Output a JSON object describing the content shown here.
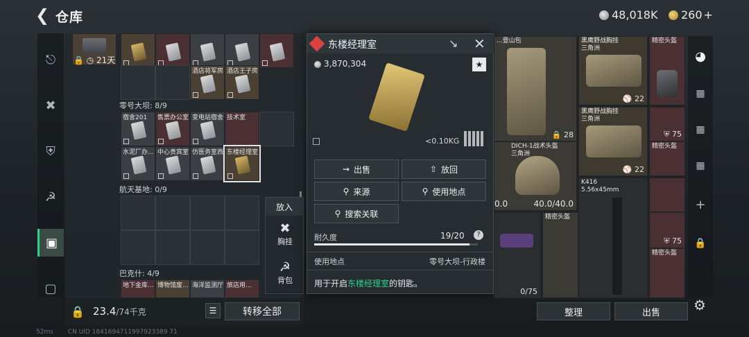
{
  "header": {
    "title": "仓库",
    "silver": "48,018K",
    "gold": "260",
    "gold_plus": "+"
  },
  "storage": {
    "timer": "21天",
    "row1_labels": [
      "",
      "",
      "",
      "",
      ""
    ],
    "row2_labels": [
      "",
      "",
      "酒店将军房",
      "酒店王子房"
    ],
    "dam_label": "零号大坝: 8/9",
    "dam_row1": [
      "宿舍201",
      "售票办公室",
      "变电站宿舍",
      "技术室"
    ],
    "dam_row2": [
      "水泥厂办...",
      "中心贵宾室",
      "仿医务室西",
      "东楼经理室"
    ],
    "space_label": "航天基地: 0/9",
    "bakshi_label": "巴克什: 4/9",
    "bakshi_row": [
      "地下金库...",
      "博物馆废...",
      "海洋监测厅",
      "旅店用..."
    ],
    "weight": "23.4",
    "weight_max": "/74千克",
    "transfer_all": "转移全部"
  },
  "context_menu": {
    "title": "放入",
    "item1": "胸挂",
    "item2": "背包"
  },
  "popup": {
    "title": "东楼经理室",
    "price": "3,870,304",
    "weight": "<0.10KG",
    "btn_sell": "出售",
    "btn_return": "放回",
    "btn_source": "来源",
    "btn_location": "使用地点",
    "btn_search": "搜索关联",
    "durability_label": "耐久度",
    "durability_value": "19/20",
    "durability_fraction": 0.95,
    "help": "?",
    "location_label": "使用地点",
    "location_value": "零号大坝-行政楼",
    "desc_prefix": "用于开启",
    "desc_link": "东楼经理室",
    "desc_suffix": "的钥匙。",
    "accent": "#2fcf8f"
  },
  "backpack": {
    "top_left_label": "...登山包",
    "item_chest1": "黑鹰野战胸挂\n三角洲",
    "item_chest1_val": "22",
    "item_mask1": "精密头盔",
    "item_chest2": "黑鹰野战胸挂\n三角洲",
    "item_chest2_val": "22",
    "item_mask2_val": "75",
    "item_mask3": "精密头盔",
    "bag_val": "28",
    "helmet_label": "DICH-1战术头盔\n三角洲",
    "helmet_val": "40.0/40.0",
    "left_val": "0.0",
    "gun_label": "K416\n5.56x45mm",
    "mask4_label": "精密头盔",
    "mask5_val": "75",
    "mask6_label": "精密头盔",
    "gun2_val": "0/75",
    "bottom_left_text": "5.56x45mm"
  },
  "bottom_buttons": {
    "organize": "整理",
    "sell": "出售"
  },
  "net": {
    "ping": "52ms",
    "uid": "CN UID 1841694711997923389 71"
  }
}
